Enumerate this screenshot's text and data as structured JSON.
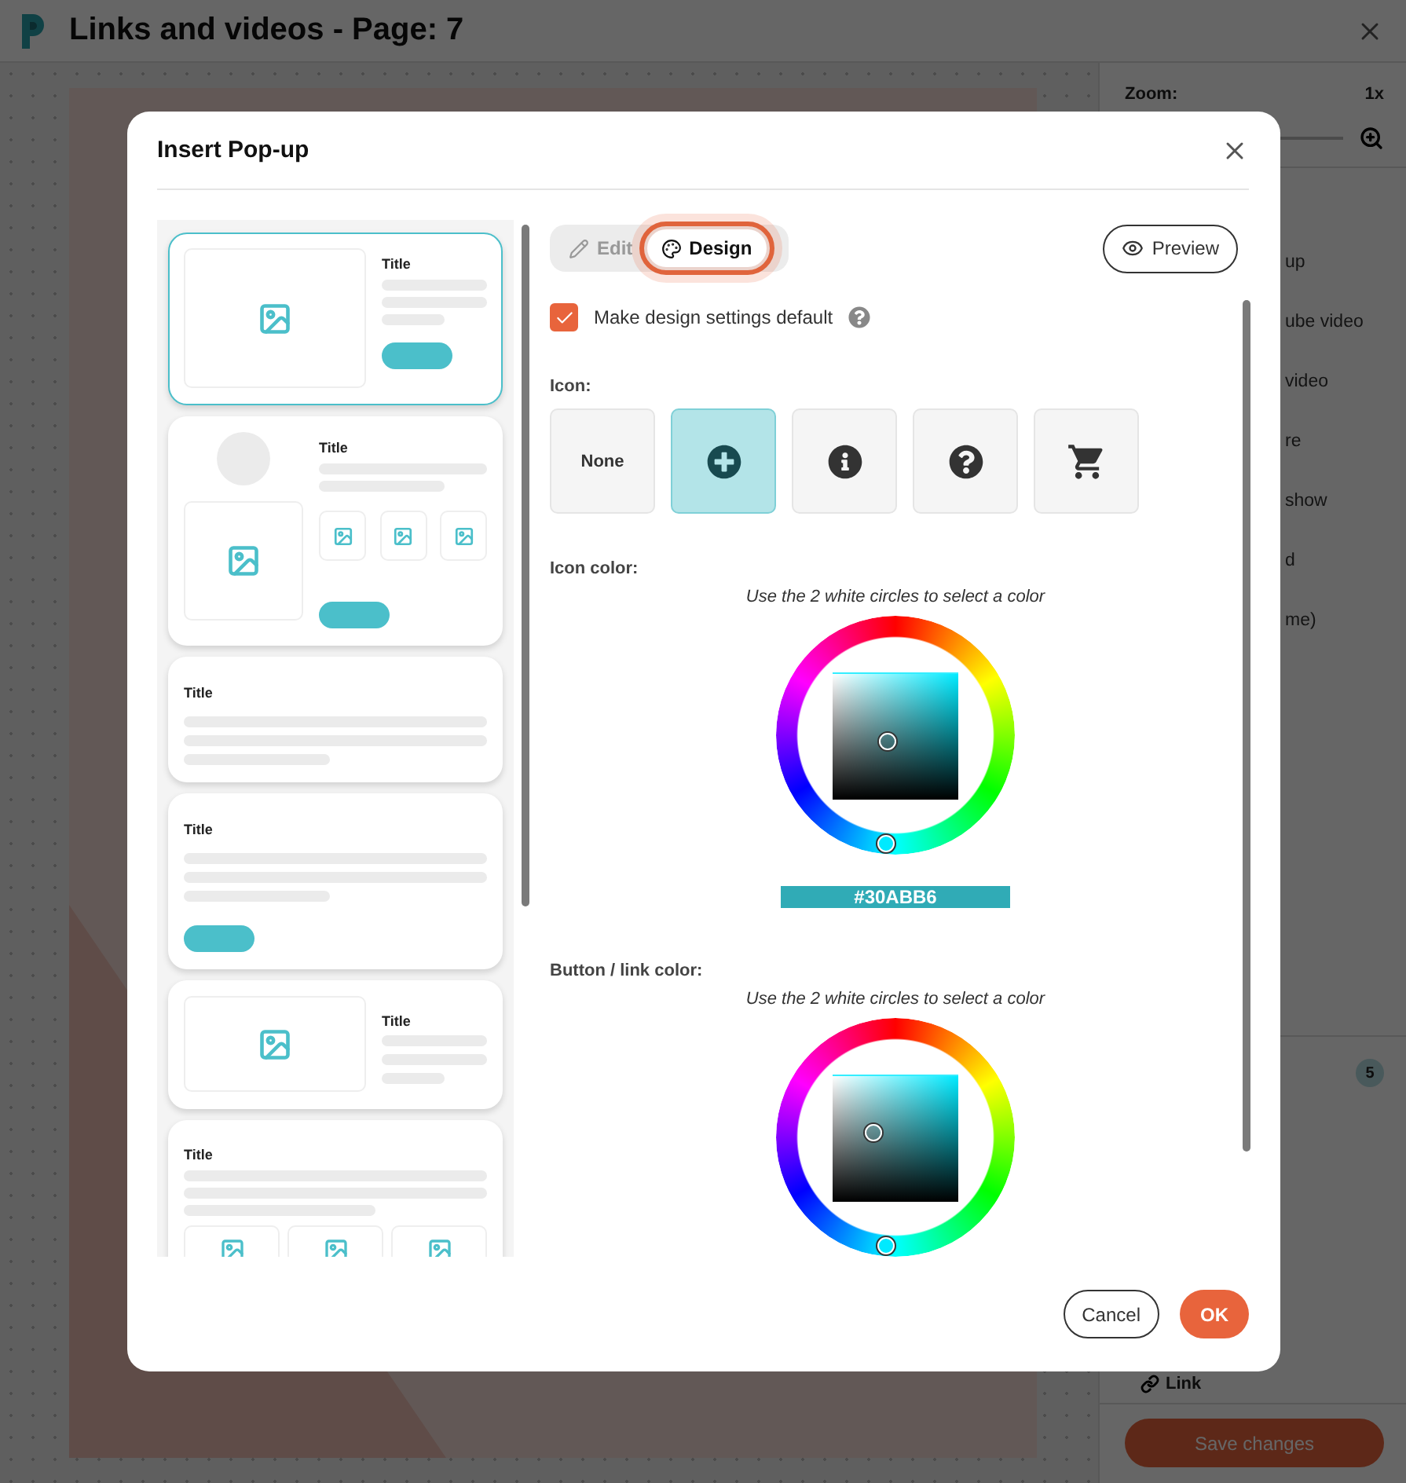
{
  "app": {
    "title": "Links and videos - Page: 7"
  },
  "side_panel": {
    "zoom_label": "Zoom:",
    "zoom_value": "1x",
    "items": [
      "up",
      "ube video",
      "video",
      "re",
      "show",
      "d",
      "me)"
    ],
    "count": "5",
    "link_label": "Link",
    "save": "Save changes"
  },
  "dialog": {
    "title": "Insert Pop-up",
    "templates": [
      {
        "kind": "image-left",
        "title": "Title",
        "selected": true
      },
      {
        "kind": "gallery",
        "title": "Title",
        "selected": false
      },
      {
        "kind": "text",
        "title": "Title",
        "selected": false
      },
      {
        "kind": "text-button",
        "title": "Title",
        "selected": false
      },
      {
        "kind": "image-text",
        "title": "Title",
        "selected": false
      },
      {
        "kind": "text-gallery",
        "title": "Title",
        "selected": false
      }
    ],
    "tabs": [
      {
        "kind": "edit",
        "label": "Edit",
        "selected": false,
        "highlighted": false
      },
      {
        "kind": "design",
        "label": "Design",
        "selected": true,
        "highlighted": true
      }
    ],
    "preview": "Preview",
    "default_checkbox": {
      "label": "Make design settings default",
      "checked": true
    },
    "icon_label": "Icon:",
    "icons": [
      {
        "kind": "none",
        "label": "None",
        "selected": false
      },
      {
        "kind": "plus",
        "selected": true
      },
      {
        "kind": "info",
        "selected": false
      },
      {
        "kind": "question",
        "selected": false
      },
      {
        "kind": "cart",
        "selected": false
      }
    ],
    "pickers": [
      {
        "label": "Icon color:",
        "hint": "Use the 2 white circles to select a color",
        "value": "#30ABB6"
      },
      {
        "label": "Button / link color:",
        "hint": "Use the 2 white circles to select a color"
      }
    ],
    "cancel": "Cancel",
    "ok": "OK"
  }
}
